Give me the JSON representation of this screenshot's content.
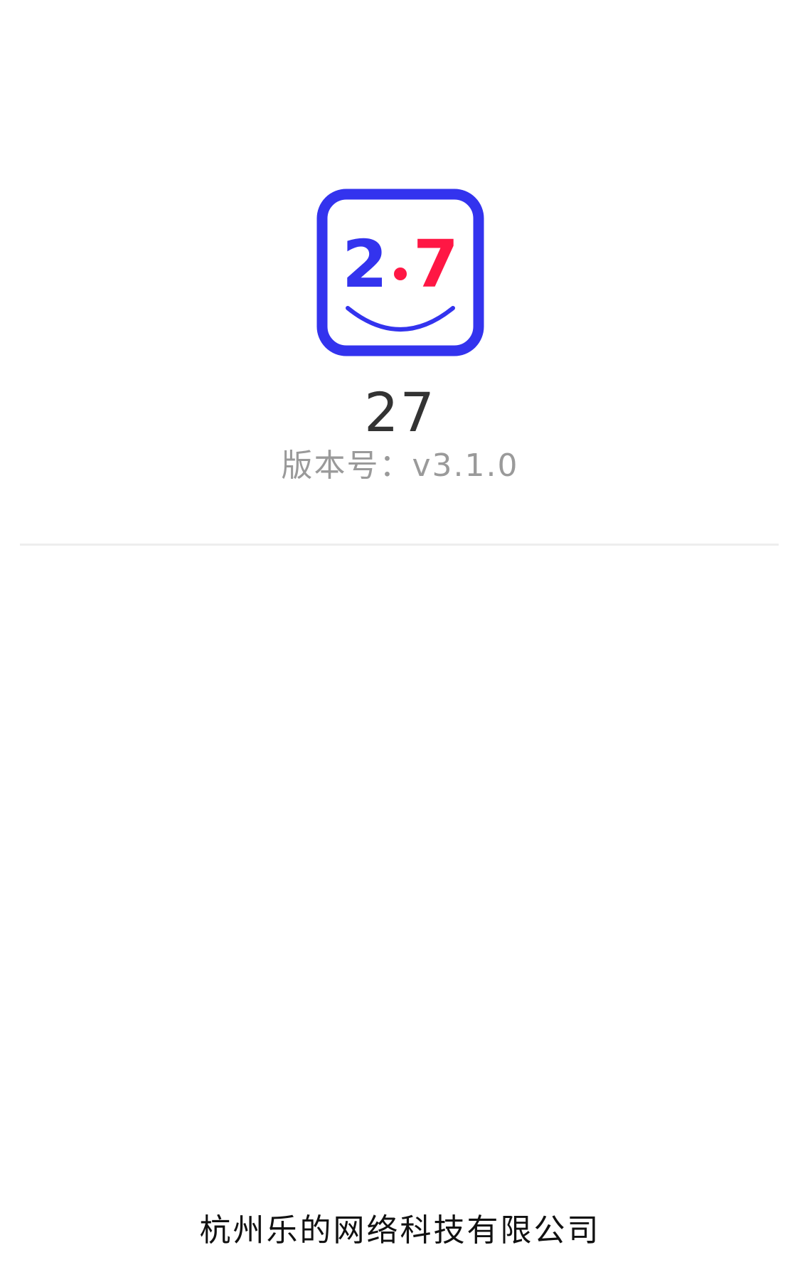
{
  "app": {
    "logo": {
      "icon": "smiley-2-7-logo-icon",
      "digit_left": "2",
      "digit_right": "7",
      "colors": {
        "frame": "#3333ee",
        "digit_left": "#3333ee",
        "dot": "#ff1744",
        "digit_right": "#ff1744",
        "smile": "#3333ee"
      }
    },
    "name": "27",
    "version_label": "版本号：",
    "version": "v3.1.0"
  },
  "footer": {
    "company": "杭州乐的网络科技有限公司"
  },
  "theme": {
    "background": "#ffffff",
    "divider": "#eeeeee",
    "title_color": "#333333",
    "version_color": "#9a9a9a"
  }
}
